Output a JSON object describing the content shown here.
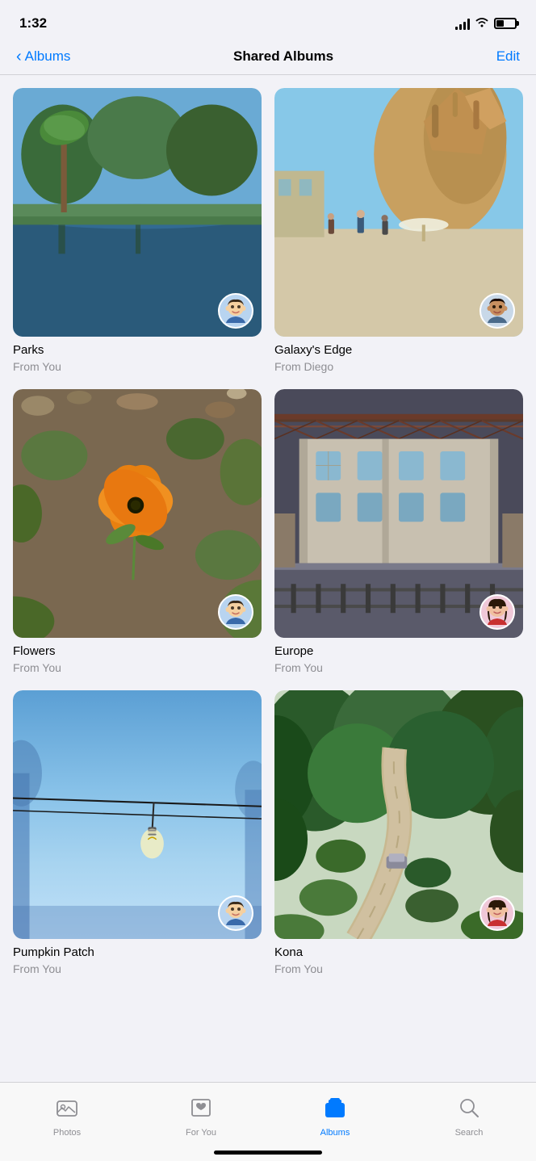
{
  "statusBar": {
    "time": "1:32",
    "signal": 4,
    "wifi": true,
    "battery": 35
  },
  "header": {
    "backLabel": "Albums",
    "title": "Shared Albums",
    "editLabel": "Edit"
  },
  "albums": [
    {
      "id": "parks",
      "name": "Parks",
      "from": "From You",
      "thumbClass": "thumb-parks",
      "avatarEmoji": "🧑",
      "avatarType": "memoji-self"
    },
    {
      "id": "galaxys-edge",
      "name": "Galaxy's Edge",
      "from": "From Diego",
      "thumbClass": "thumb-galaxy",
      "avatarEmoji": "👨",
      "avatarType": "memoji-diego"
    },
    {
      "id": "flowers",
      "name": "Flowers",
      "from": "From You",
      "thumbClass": "thumb-flowers",
      "avatarEmoji": "🧑",
      "avatarType": "memoji-self"
    },
    {
      "id": "europe",
      "name": "Europe",
      "from": "From You",
      "thumbClass": "thumb-europe",
      "avatarEmoji": "👩",
      "avatarType": "memoji-other"
    },
    {
      "id": "pumpkin-patch",
      "name": "Pumpkin Patch",
      "from": "From You",
      "thumbClass": "thumb-pumpkin",
      "avatarEmoji": "🧑",
      "avatarType": "memoji-self"
    },
    {
      "id": "kona",
      "name": "Kona",
      "from": "From You",
      "thumbClass": "thumb-kona",
      "avatarEmoji": "👩",
      "avatarType": "memoji-other"
    }
  ],
  "tabBar": {
    "tabs": [
      {
        "id": "photos",
        "label": "Photos",
        "icon": "photos"
      },
      {
        "id": "for-you",
        "label": "For You",
        "icon": "for-you"
      },
      {
        "id": "albums",
        "label": "Albums",
        "icon": "albums",
        "active": true
      },
      {
        "id": "search",
        "label": "Search",
        "icon": "search"
      }
    ]
  }
}
